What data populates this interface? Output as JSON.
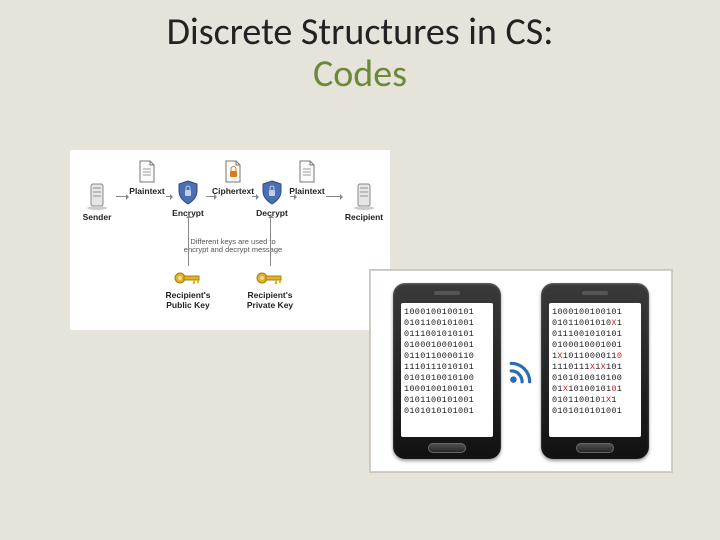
{
  "title": {
    "line1": "Discrete Structures in CS:",
    "line2": "Codes"
  },
  "crypto": {
    "sender": "Sender",
    "recipient": "Recipient",
    "plaintext": "Plaintext",
    "ciphertext": "Ciphertext",
    "encrypt": "Encrypt",
    "decrypt": "Decrypt",
    "public_key": "Recipient's Public Key",
    "private_key": "Recipient's Private Key",
    "different": "Different keys are used to encrypt and decrypt message"
  },
  "phone_left": {
    "rows": [
      "1000100100101",
      "0101100101001",
      "0111001010101",
      "0100010001001",
      "0110110000110",
      "1110111010101",
      "0101010010100",
      "1000100100101",
      "0101100101001",
      "0101010101001"
    ]
  },
  "phone_right": {
    "rows_html": [
      "1000100100101",
      "01011001010<span class='r'>X</span>1",
      "0111001010101",
      "0100010001001",
      "1<span class='r'>X</span>1011000011<span class='r'>0</span>",
      "1110111<span class='r'>X</span>1<span class='r'>X</span>101",
      "0101010010100",
      "01<span class='r'>X</span>10100101<span class='r'>0</span>1",
      "010110010<span class='r'>1X</span>1",
      "0101010101001"
    ]
  }
}
